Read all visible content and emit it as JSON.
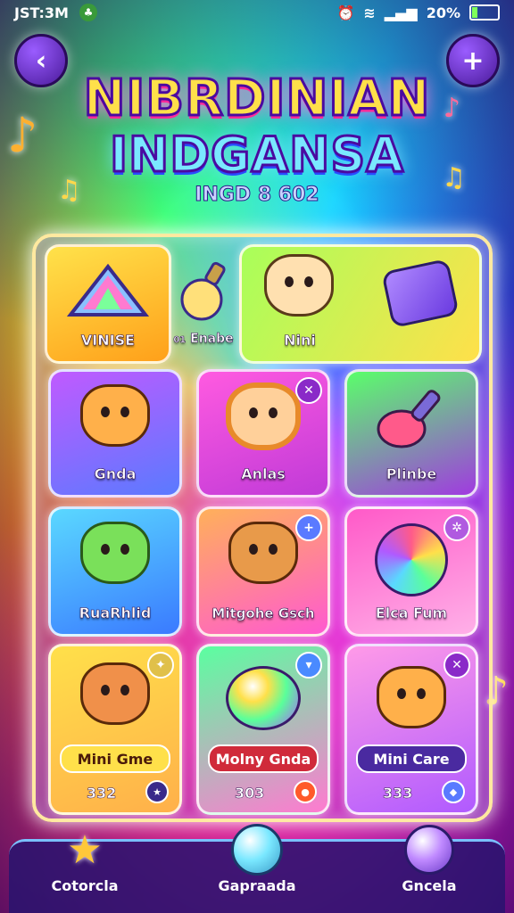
{
  "status": {
    "time": "JST:3M",
    "battery": "20%"
  },
  "header": {
    "title_line1": "NIBRDINIAN",
    "title_line2": "INDGANSA",
    "subtitle": "INGD 8 602"
  },
  "cards": [
    {
      "label": "VINISE",
      "icon": "prism-icon"
    },
    {
      "label": "Enabe",
      "prefix": "01",
      "icon": "bulb-icon"
    },
    {
      "label": "Nini",
      "icon": "hamster-icon"
    },
    {
      "label": "",
      "icon": "cube-icon"
    },
    {
      "label": "Gnda",
      "icon": "monkey-icon"
    },
    {
      "label": "Anlas",
      "icon": "girl-icon"
    },
    {
      "label": "Plinbe",
      "icon": "potion-icon"
    },
    {
      "label": "RuaRhlid",
      "icon": "dragon-icon"
    },
    {
      "label": "Mitgohe Gsch",
      "icon": "bear-icon"
    },
    {
      "label": "Elca Fum",
      "icon": "globe-icon"
    },
    {
      "label": "Mini Gme",
      "count": "332",
      "icon": "cat-icon"
    },
    {
      "label": "Molny Gnda",
      "count": "303",
      "icon": "blob-icon"
    },
    {
      "label": "Mini Care",
      "count": "333",
      "icon": "fox-icon"
    }
  ],
  "nav": {
    "items": [
      {
        "label": "Cotorcla",
        "icon": "star-icon"
      },
      {
        "label": "Gapraada",
        "icon": "slime-icon"
      },
      {
        "label": "Gncela",
        "icon": "orb-icon"
      }
    ]
  },
  "colors": {
    "accent": "#ffe04a",
    "board_border": "#ffe9a0",
    "nav_bg": "#28146e"
  }
}
